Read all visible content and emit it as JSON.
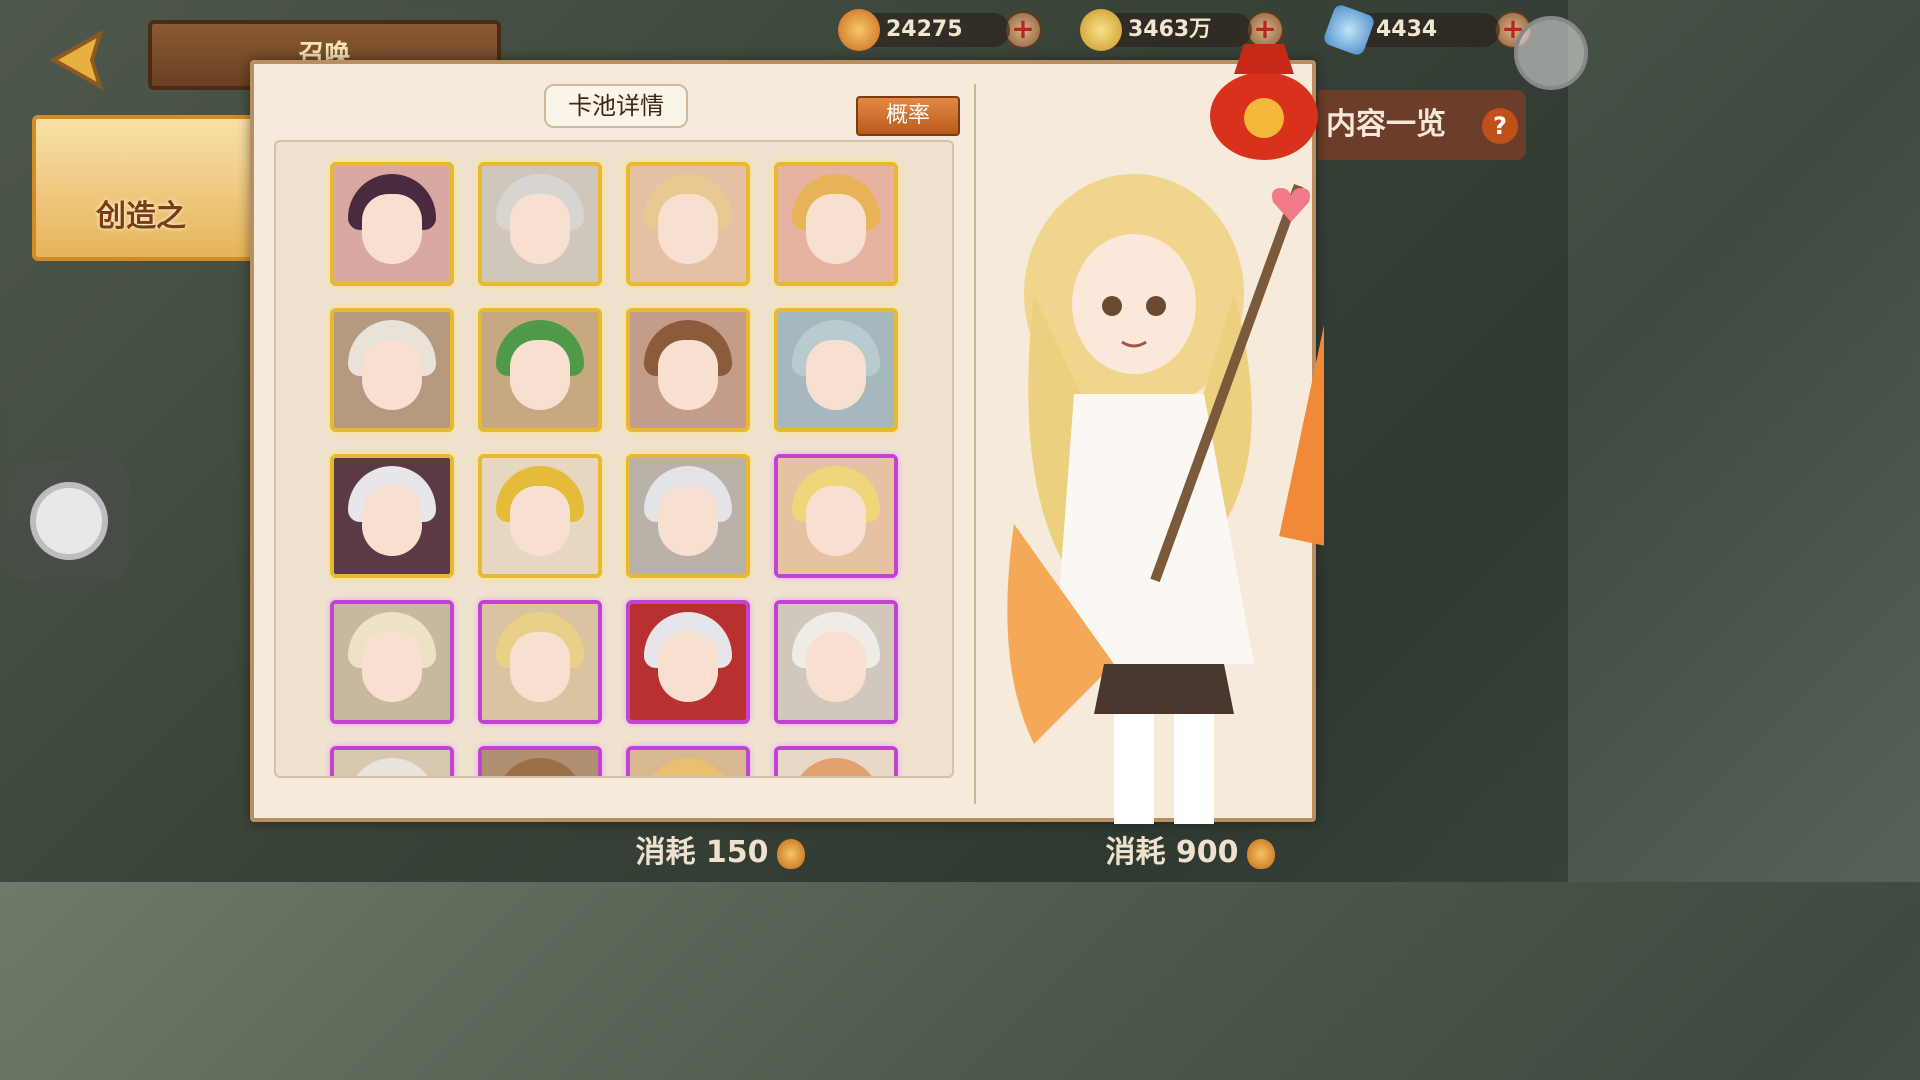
{
  "header": {
    "title": "召唤",
    "resources": [
      {
        "name": "lotus-bulb",
        "value": "24275",
        "color": "#e8a040"
      },
      {
        "name": "gold-coin",
        "value": "3463万",
        "color": "#e6b83a"
      },
      {
        "name": "crystal",
        "value": "4434",
        "color": "#6fb8e8"
      }
    ]
  },
  "side_banner": {
    "label": "创造之"
  },
  "content_list": {
    "label": "内容一览"
  },
  "dialog": {
    "title": "卡池详情",
    "rate_button": "概率",
    "cards": [
      {
        "rarity": "gold",
        "hair": "#4a2a3e",
        "bg": "#d7a9a1"
      },
      {
        "rarity": "gold",
        "hair": "#d8d4cf",
        "bg": "#cfc7bb"
      },
      {
        "rarity": "gold",
        "hair": "#e9c992",
        "bg": "#e6c0a5"
      },
      {
        "rarity": "gold",
        "hair": "#e9b35a",
        "bg": "#e7b2a0"
      },
      {
        "rarity": "gold",
        "hair": "#e8e2d8",
        "bg": "#b59a80"
      },
      {
        "rarity": "gold",
        "hair": "#4f9a48",
        "bg": "#c7a880"
      },
      {
        "rarity": "gold",
        "hair": "#8b5b3b",
        "bg": "#c49d8a"
      },
      {
        "rarity": "gold",
        "hair": "#b8ccd0",
        "bg": "#a7b7c0"
      },
      {
        "rarity": "gold",
        "hair": "#e8e6ea",
        "bg": "#5b3a46"
      },
      {
        "rarity": "gold",
        "hair": "#e6bb3a",
        "bg": "#e7d6c0"
      },
      {
        "rarity": "gold",
        "hair": "#e4e4e8",
        "bg": "#b9b2a8"
      },
      {
        "rarity": "purple",
        "hair": "#f0d67a",
        "bg": "#e6c2a3"
      },
      {
        "rarity": "purple",
        "hair": "#eee2c6",
        "bg": "#c7b89e"
      },
      {
        "rarity": "purple",
        "hair": "#e8d088",
        "bg": "#d9c3a0"
      },
      {
        "rarity": "purple",
        "hair": "#e6e6ea",
        "bg": "#b83030"
      },
      {
        "rarity": "purple",
        "hair": "#efece6",
        "bg": "#d0c8bc"
      },
      {
        "rarity": "purple",
        "hair": "#e8e4dc",
        "bg": "#d8c8b0"
      },
      {
        "rarity": "purple",
        "hair": "#9a7048",
        "bg": "#b09070"
      },
      {
        "rarity": "purple",
        "hair": "#e8c070",
        "bg": "#d8b890"
      },
      {
        "rarity": "purple",
        "hair": "#e0a070",
        "bg": "#e8d8c8"
      }
    ]
  },
  "footer": {
    "cost_single": "消耗 150",
    "cost_multi": "消耗 900"
  },
  "colors": {
    "accent": "#c4632a",
    "gold_frame": "#e8b830",
    "purple_frame": "#c243d2"
  }
}
